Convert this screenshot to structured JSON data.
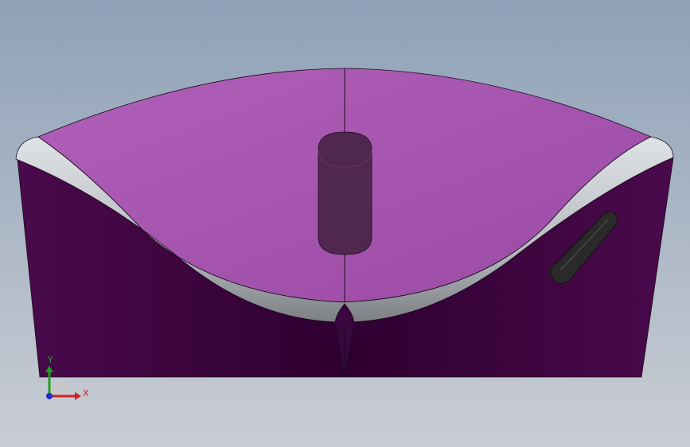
{
  "viewport": {
    "background_top": "#8fa1b8",
    "background_bottom": "#c9cdd4"
  },
  "model": {
    "top_face_color": "#b060b8",
    "top_face_shade": "#9a4aa4",
    "front_face_color": "#4a0a4c",
    "front_face_dark": "#2e0030",
    "rim_color": "#b8bcc0",
    "button_color": "#50284f",
    "scroll_wheel_color": "#2a2a2a",
    "edge_color": "#1a0a1a"
  },
  "triad": {
    "x_label": "X",
    "y_label": "Y",
    "x_color": "#d02020",
    "y_color": "#20a020",
    "origin_color": "#1a2ad0"
  }
}
